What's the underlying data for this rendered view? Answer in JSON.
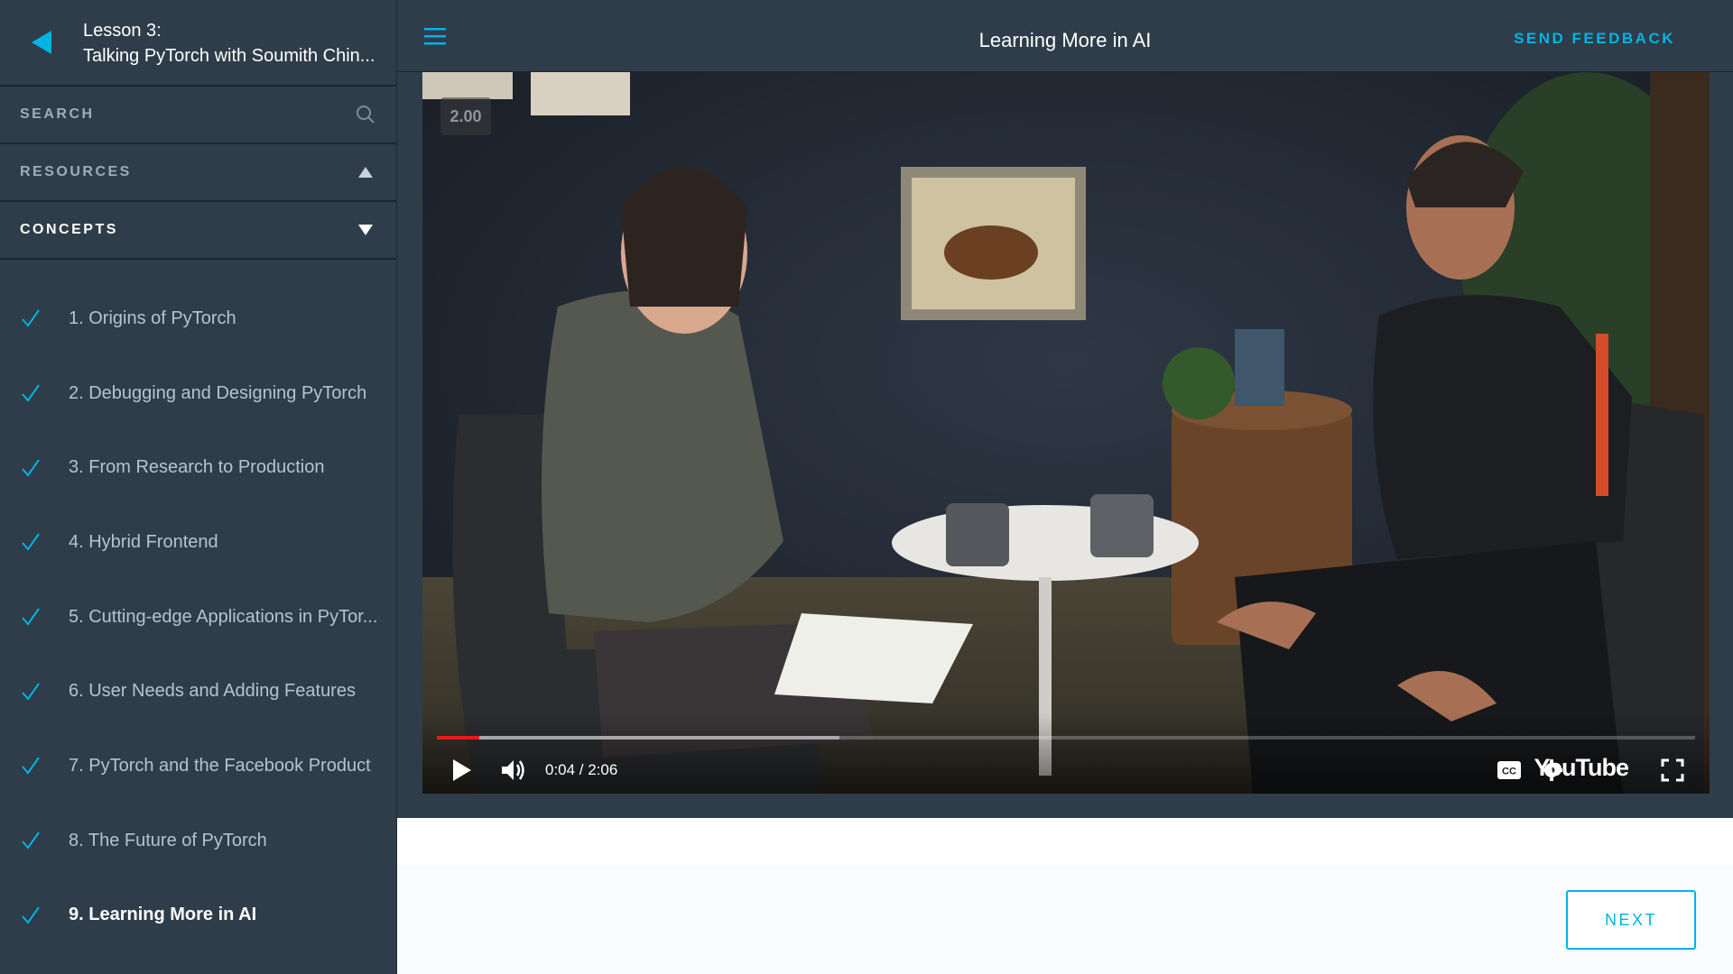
{
  "sidebar": {
    "lesson_number": "Lesson 3:",
    "lesson_title": "Talking PyTorch with Soumith Chin...",
    "search_label": "SEARCH",
    "resources_label": "RESOURCES",
    "concepts_label": "CONCEPTS",
    "concepts": [
      {
        "label": "1. Origins of PyTorch",
        "completed": true,
        "active": false
      },
      {
        "label": "2. Debugging and Designing PyTorch",
        "completed": true,
        "active": false
      },
      {
        "label": "3. From Research to Production",
        "completed": true,
        "active": false
      },
      {
        "label": "4. Hybrid Frontend",
        "completed": true,
        "active": false
      },
      {
        "label": "5. Cutting-edge Applications in PyTor...",
        "completed": true,
        "active": false
      },
      {
        "label": "6. User Needs and Adding Features",
        "completed": true,
        "active": false
      },
      {
        "label": "7. PyTorch and the Facebook Product",
        "completed": true,
        "active": false
      },
      {
        "label": "8. The Future of PyTorch",
        "completed": true,
        "active": false
      },
      {
        "label": "9. Learning More in AI",
        "completed": true,
        "active": true
      }
    ]
  },
  "header": {
    "title": "Learning More in AI",
    "feedback_label": "SEND FEEDBACK"
  },
  "video": {
    "speed_overlay": "2.00",
    "time": "0:04 / 2:06",
    "played_fraction": 0.034,
    "buffered_fraction": 0.32,
    "brand": "YouTube"
  },
  "footer": {
    "next_label": "NEXT"
  },
  "colors": {
    "accent": "#02b3e4",
    "sidebar_bg": "#2e3d49",
    "progress_played": "#e51b1b"
  },
  "icons": [
    "back-arrow-icon",
    "search-icon",
    "triangle-up-icon",
    "triangle-down-icon",
    "check-icon",
    "hamburger-menu-icon",
    "play-icon",
    "volume-icon",
    "captions-icon",
    "settings-gear-icon",
    "fullscreen-icon"
  ]
}
